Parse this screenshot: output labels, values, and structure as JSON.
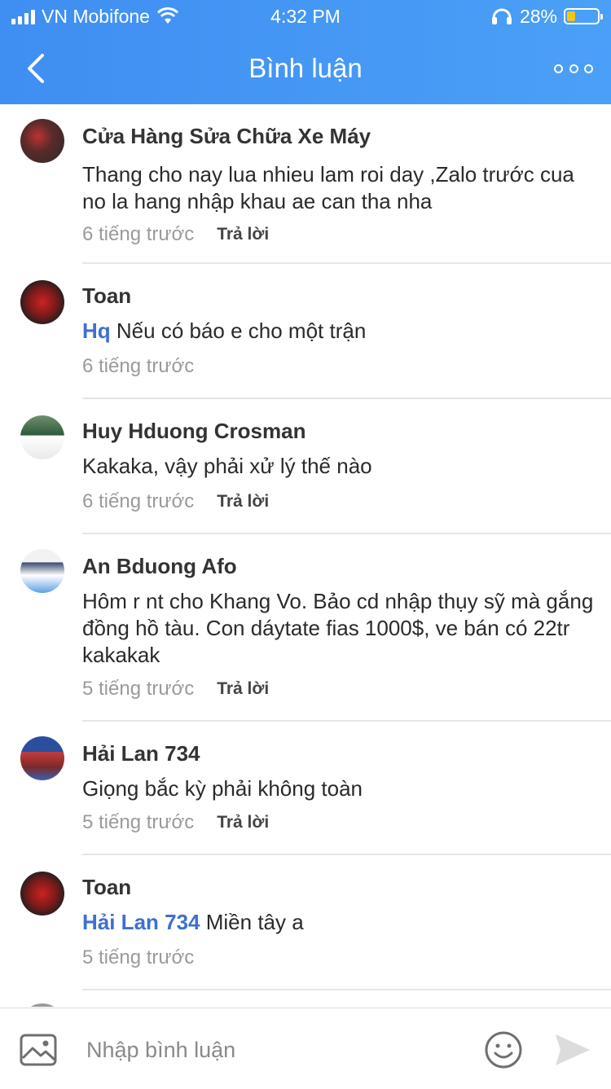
{
  "status": {
    "carrier": "VN Mobifone",
    "time": "4:32 PM",
    "battery": "28%",
    "battery_level": 0.28
  },
  "nav": {
    "title": "Bình luận",
    "back_icon": "chevron-left-icon",
    "more_icon": "more-dots-icon"
  },
  "comments": [
    {
      "name": "Cửa Hàng Sửa Chữa Xe Máy",
      "mention": "",
      "text": "Thang cho nay lua nhieu lam roi day ,Zalo trước cua no la hang nhập khau ae can tha nha",
      "time": "6 tiếng trước",
      "reply": "Trả lời"
    },
    {
      "name": "Toan",
      "mention": "Hq",
      "text": " Nếu có báo e cho một trận",
      "time": "6 tiếng trước",
      "reply": ""
    },
    {
      "name": "Huy Hduong Crosman",
      "mention": "",
      "text": "Kakaka, vậy phải xử lý thế nào",
      "time": "6 tiếng trước",
      "reply": "Trả lời"
    },
    {
      "name": "An Bduong Afo",
      "mention": "",
      "text": "Hôm r nt cho Khang Vo. Bảo cd nhập thụy sỹ mà gắng đồng hồ tàu. Con dáytate fias 1000$, ve bán có 22tr kakakak",
      "time": "5 tiếng trước",
      "reply": "Trả lời"
    },
    {
      "name": "Hải Lan 734",
      "mention": "",
      "text": "Giọng bắc kỳ phải không toàn",
      "time": "5 tiếng trước",
      "reply": "Trả lời"
    },
    {
      "name": "Toan",
      "mention": "Hải Lan 734",
      "text": " Miền tây a",
      "time": "5 tiếng trước",
      "reply": ""
    }
  ],
  "composer": {
    "placeholder": "Nhập bình luận",
    "image_icon": "image-icon",
    "emoji_icon": "smiley-icon",
    "send_icon": "send-icon"
  },
  "colors": {
    "header": "#4aa0f6",
    "mention": "#3d6fd1"
  }
}
